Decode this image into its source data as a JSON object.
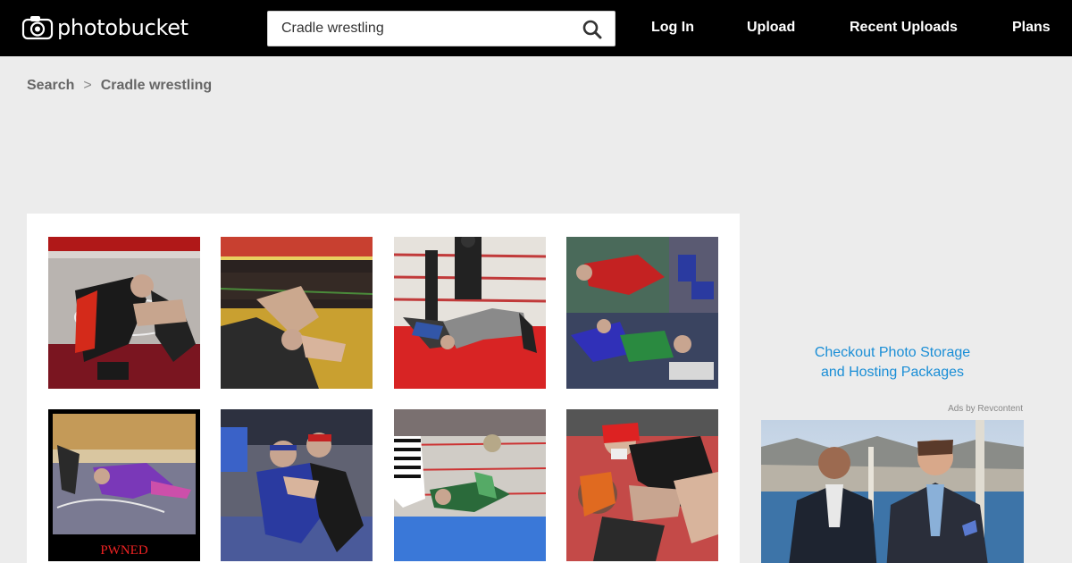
{
  "header": {
    "logo_text": "photobucket",
    "search": {
      "value": "Cradle wrestling"
    },
    "nav": [
      "Log In",
      "Upload",
      "Recent Uploads",
      "Plans"
    ]
  },
  "breadcrumb": {
    "root": "Search",
    "separator": ">",
    "current": "Cradle wrestling"
  },
  "grid": {
    "captions": {
      "pwned": "PWNED"
    }
  },
  "sidebar": {
    "promo_line1": "Checkout Photo Storage",
    "promo_line2": "and Hosting Packages",
    "ads_by": "Ads by Revcontent"
  },
  "colors": {
    "header_bg": "#000000",
    "page_bg": "#ececec",
    "link": "#1a8ed6"
  }
}
